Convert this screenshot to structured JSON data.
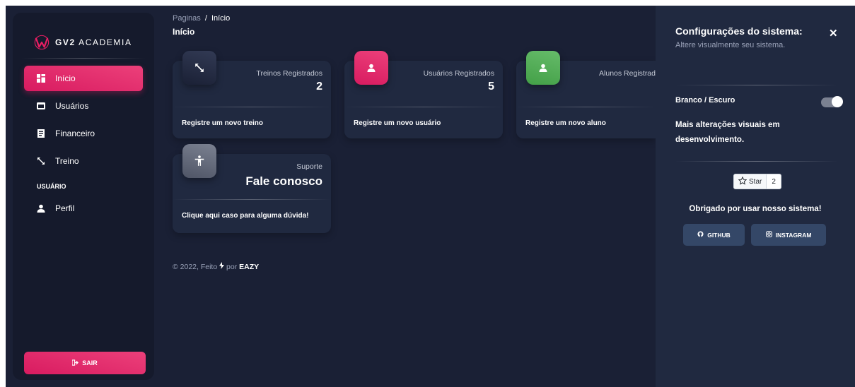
{
  "brand": {
    "name_bold": "GV2",
    "name_rest": "ACADEMIA"
  },
  "sidebar": {
    "items": [
      {
        "label": "Início",
        "icon": "dashboard-icon"
      },
      {
        "label": "Usuários",
        "icon": "table-icon"
      },
      {
        "label": "Financeiro",
        "icon": "receipt-icon"
      },
      {
        "label": "Treino",
        "icon": "expand-arrows-icon"
      }
    ],
    "section_user": "USUÁRIO",
    "profile": {
      "label": "Perfil",
      "icon": "person-icon"
    },
    "logout_label": "SAIR"
  },
  "header": {
    "breadcrumb_root": "Paginas",
    "breadcrumb_sep": "/",
    "breadcrumb_current": "Início",
    "title": "Início"
  },
  "cards": [
    {
      "label": "Treinos Registrados",
      "value": "2",
      "footer": "Registre um novo treino",
      "icon": "expand-arrows-icon"
    },
    {
      "label": "Usuários Registrados",
      "value": "5",
      "footer": "Registre um novo usuário",
      "icon": "person-icon"
    },
    {
      "label": "Alunos Registrad",
      "value": "",
      "footer": "Registre um novo aluno",
      "icon": "person-icon"
    },
    {
      "label": "Suporte",
      "value": "Fale conosco",
      "footer": "Clique aqui caso para alguma dúvida!",
      "icon": "accessibility-icon"
    }
  ],
  "footer": {
    "prefix": "© 2022, Feito",
    "middle": "por",
    "author": "EAZY"
  },
  "config": {
    "title": "Configurações do sistema:",
    "subtitle": "Altere visualmente seu sistema.",
    "theme_label": "Branco / Escuro",
    "theme_toggle_on": true,
    "note": "Mais alterações visuais em desenvolvimento.",
    "star_label": "Star",
    "star_count": "2",
    "thanks": "Obrigado por usar nosso sistema!",
    "github_label": "GITHUB",
    "instagram_label": "INSTAGRAM"
  },
  "colors": {
    "background": "#1a2035",
    "sidebar": "#151a2c",
    "card": "#202940",
    "accent_pink": "#e91e63",
    "accent_green": "#4caf50",
    "button_blue": "#344767"
  }
}
